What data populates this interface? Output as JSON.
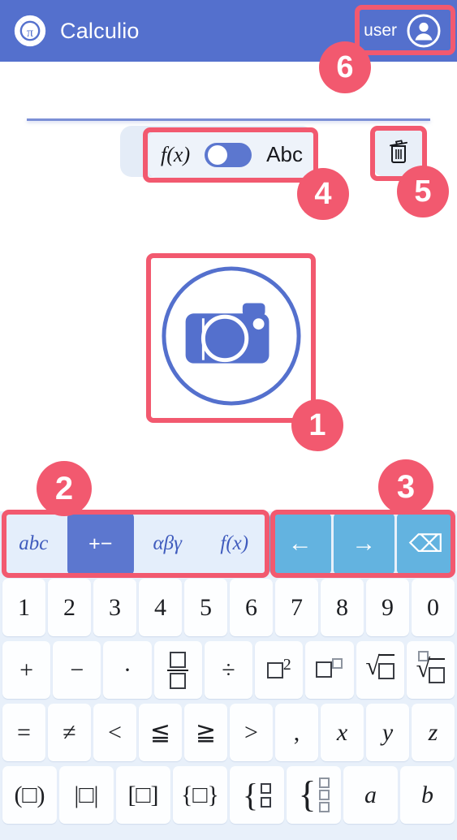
{
  "header": {
    "logo_icon": "pi-logo-icon",
    "title": "Calculio",
    "user_label": "user",
    "avatar_icon": "user-avatar-icon",
    "background_color": "#5470cd"
  },
  "toolbar": {
    "fx_label": "f(x)",
    "abc_label": "Abc",
    "toggle_state": "left",
    "trash_icon": "trash-icon"
  },
  "camera": {
    "icon": "camera-icon",
    "color": "#5470cd"
  },
  "keyboard": {
    "modes": [
      {
        "label": "abc",
        "active": false
      },
      {
        "label": "+−",
        "active": true
      },
      {
        "label": "αβγ",
        "active": false
      },
      {
        "label": "f(x)",
        "active": false
      }
    ],
    "nav": [
      {
        "icon": "arrow-left-icon",
        "glyph": "←"
      },
      {
        "icon": "arrow-right-icon",
        "glyph": "→"
      },
      {
        "icon": "backspace-icon",
        "glyph": "⌫"
      }
    ],
    "rows": [
      {
        "name": "number-row",
        "keys": [
          "1",
          "2",
          "3",
          "4",
          "5",
          "6",
          "7",
          "8",
          "9",
          "0"
        ]
      },
      {
        "name": "operator-row",
        "keys": [
          "+",
          "−",
          "·",
          "fraction",
          "÷",
          "square",
          "power",
          "sqrt",
          "nth-root"
        ]
      },
      {
        "name": "relation-row",
        "keys": [
          "=",
          "≠",
          "<",
          "≦",
          "≧",
          ">",
          ",",
          "x",
          "y",
          "z"
        ]
      },
      {
        "name": "bracket-row",
        "keys": [
          "(□)",
          "|□|",
          "[□]",
          "{□}",
          "cases2",
          "cases3",
          "a",
          "b"
        ]
      }
    ],
    "background_color": "#e8f0fa",
    "active_key_color": "#5c77cf",
    "nav_key_color": "#63b3e0"
  },
  "annotations": {
    "accent_color": "#f2596f",
    "markers": [
      {
        "number": "1",
        "target": "camera-button"
      },
      {
        "number": "2",
        "target": "keyboard-mode-group"
      },
      {
        "number": "3",
        "target": "keyboard-nav-group"
      },
      {
        "number": "4",
        "target": "fx-abc-toggle"
      },
      {
        "number": "5",
        "target": "clear-button"
      },
      {
        "number": "6",
        "target": "user-account-button"
      }
    ]
  }
}
